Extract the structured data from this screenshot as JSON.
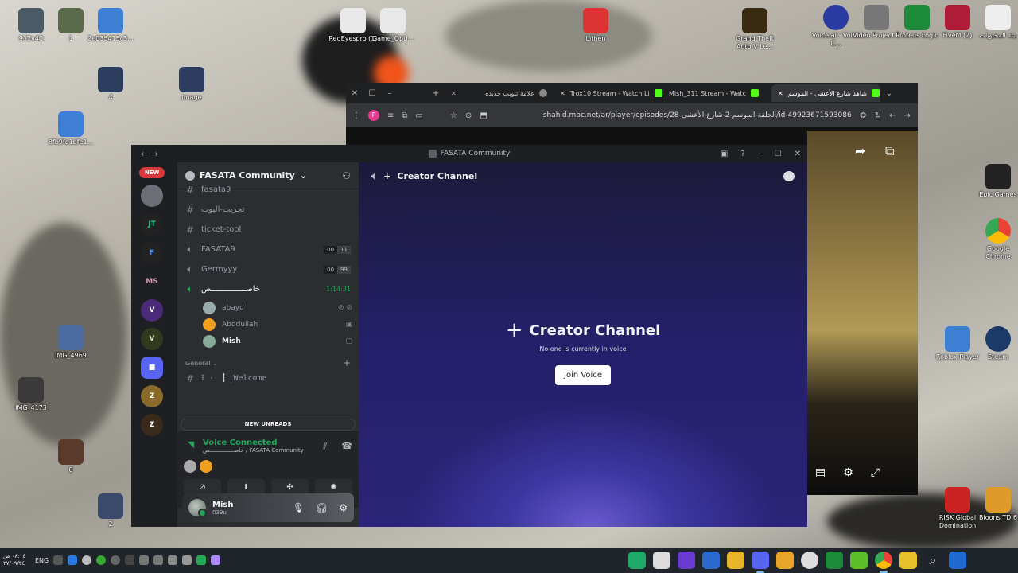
{
  "desktop": {
    "icons_left": [
      {
        "label": "932v40",
        "color": "#4a5a66"
      },
      {
        "label": "1",
        "color": "#5b6a4a"
      },
      {
        "label": "2e035415c3...",
        "color": "#3d7fd6"
      },
      {
        "label": "4",
        "color": "#2c3e60"
      },
      {
        "label": "image",
        "color": "#2c3e60"
      },
      {
        "label": "8fb9fe1bfe1...",
        "color": "#3d7fd6"
      },
      {
        "label": "IMG_4969",
        "color": "#4a6aa0"
      },
      {
        "label": "IMG_4173",
        "color": "#3a3a3a"
      },
      {
        "label": "0",
        "color": "#5a3a2a"
      },
      {
        "label": "2",
        "color": "#3a4a6a"
      }
    ],
    "icons_top": [
      {
        "label": "RedEyespro (1)",
        "color": "#e8e8e8"
      },
      {
        "label": "Game_Opti...",
        "color": "#e8e8e8"
      },
      {
        "label": "Lithen",
        "color": "#d33"
      },
      {
        "label": "Grand Theft Auto V Le...",
        "color": "#3b2a12"
      }
    ],
    "icons_right": [
      {
        "label": "Voice.ai - Voice C...",
        "color": "#2a3aa0"
      },
      {
        "label": "Video Project 1",
        "color": "#777"
      },
      {
        "label": "Proteus Logic",
        "color": "#1d8a3a"
      },
      {
        "label": "FiveM (2)",
        "color": "#b01c38"
      },
      {
        "label": "بيئة المحتويات",
        "color": "#eee"
      },
      {
        "label": "Roblox Player",
        "color": "#3d7fd6"
      },
      {
        "label": "Steam",
        "color": "#1b3a6a"
      },
      {
        "label": "Epic Games",
        "color": "#222"
      },
      {
        "label": "Google Chrome",
        "color": "#fff"
      },
      {
        "label": "RISK Global Domination",
        "color": "#c22"
      },
      {
        "label": "Bloons TD 6",
        "color": "#e09a2a"
      }
    ]
  },
  "taskbar": {
    "time": "٠٨:٠٤ ص",
    "date": "٢٧/٠٩/٢٤",
    "lang": "ENG",
    "apps": [
      "#1faa6a",
      "#ddd",
      "#6a3ad0",
      "#2a6acc",
      "#e8b52a",
      "#5865f2",
      "#e8a52a",
      "#ddd",
      "#1d8a3a",
      "#5cbf2a",
      "#4285f4",
      "#e8c02a",
      "#1e6ad0"
    ]
  },
  "browser": {
    "tabs": [
      {
        "label": "علامة تبويب جديدة",
        "color": "#888"
      },
      {
        "label": "Trox10 Stream - Watch Li",
        "color": "#53fc18"
      },
      {
        "label": "Mish_311 Stream - Watc",
        "color": "#53fc18"
      },
      {
        "label": "شاهد شارع الأعشى - الموسم",
        "color": "#53fc18"
      }
    ],
    "url": "shahid.mbc.net/ar/player/episodes/28-الحلقة-الموسم-2-شارع-الأعشى/id-49923671593086",
    "profile": "P"
  },
  "discord": {
    "window_title": "FASATA Community",
    "new_label": "NEW",
    "guilds": [
      {
        "label": "",
        "color": "#6d6f78"
      },
      {
        "label": "JT",
        "color": "#222"
      },
      {
        "label": "F",
        "color": "#222"
      },
      {
        "label": "MS",
        "color": "#1e1f22"
      },
      {
        "label": "V",
        "color": "#4b2a7a"
      },
      {
        "label": "V",
        "color": "#2f3a1e"
      },
      {
        "label": "■",
        "color": "#5865f2"
      },
      {
        "label": "Z",
        "color": "#8a6a2a"
      },
      {
        "label": "Z",
        "color": "#3a2a1a"
      }
    ],
    "server_name": "FASATA Community",
    "channels": [
      {
        "type": "text",
        "name": "fasata9"
      },
      {
        "type": "text",
        "name": "تجربت-البوت"
      },
      {
        "type": "text",
        "name": "ticket-tool"
      },
      {
        "type": "voice",
        "name": "FASATA9",
        "count_a": "00",
        "count_b": "11"
      },
      {
        "type": "voice",
        "name": "Germyyy",
        "count_a": "00",
        "count_b": "99"
      }
    ],
    "active_voice": {
      "name": "خاصـــــــــــــــص",
      "timer": "1:14:31"
    },
    "voice_users": [
      {
        "name": "abayd",
        "status": "🔇̸",
        "color": "#9aa"
      },
      {
        "name": "Abddullah",
        "status": "▣",
        "color": "#f0a020"
      },
      {
        "name": "Mish",
        "status": "▢",
        "color": "#8a9"
      }
    ],
    "category": "General",
    "welcome_channel": "𝕀 · ❕│Welcome",
    "new_unreads": "NEW UNREADS",
    "voice": {
      "status": "Voice Connected",
      "sub": "خاصـــــــــــــــص / FASATA Community"
    },
    "user": {
      "name": "Mish",
      "tag": "039u"
    },
    "main": {
      "channel_name": "Creator Channel",
      "center_title": "Creator Channel",
      "center_sub": "No one is currently in voice",
      "join_label": "Join Voice"
    }
  }
}
